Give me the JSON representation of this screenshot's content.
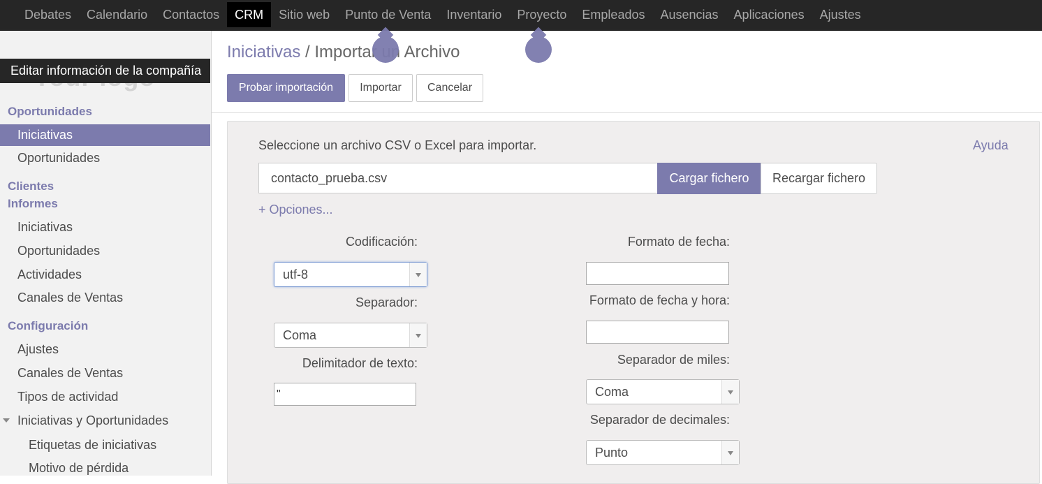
{
  "nav": {
    "items": [
      "Debates",
      "Calendario",
      "Contactos",
      "CRM",
      "Sitio web",
      "Punto de Venta",
      "Inventario",
      "Proyecto",
      "Empleados",
      "Ausencias",
      "Aplicaciones",
      "Ajustes"
    ],
    "active": "CRM"
  },
  "sidebar": {
    "logo_text": "Your logo",
    "company_tooltip": "Editar información de la compañía",
    "sections": {
      "oportunidades": "Oportunidades",
      "clientes": "Clientes",
      "informes": "Informes",
      "configuracion": "Configuración"
    },
    "items": {
      "iniciativas": "Iniciativas",
      "oportunidades": "Oportunidades",
      "inf_iniciativas": "Iniciativas",
      "inf_oportunidades": "Oportunidades",
      "inf_actividades": "Actividades",
      "inf_canales": "Canales de Ventas",
      "conf_ajustes": "Ajustes",
      "conf_canales": "Canales de Ventas",
      "conf_tipos": "Tipos de actividad",
      "conf_iniciativas_op": "Iniciativas y Oportunidades",
      "conf_etiquetas": "Etiquetas de iniciativas",
      "conf_motivo": "Motivo de pérdida"
    }
  },
  "header": {
    "breadcrumb_link": "Iniciativas",
    "breadcrumb_sep": "/",
    "breadcrumb_current": "Importar un Archivo",
    "buttons": {
      "test": "Probar importación",
      "import": "Importar",
      "cancel": "Cancelar"
    }
  },
  "import": {
    "prompt": "Seleccione un archivo CSV o Excel para importar.",
    "help": "Ayuda",
    "file_name": "contacto_prueba.csv",
    "load_button": "Cargar fichero",
    "reload_button": "Recargar fichero",
    "options_toggle": "+ Opciones...",
    "encoding_label": "Codificación:",
    "encoding_value": "utf-8",
    "separator_label": "Separador:",
    "separator_value": "Coma",
    "text_delimiter_label": "Delimitador de texto:",
    "text_delimiter_value": "\"",
    "date_format_label": "Formato de fecha:",
    "date_format_value": "",
    "datetime_format_label": "Formato de fecha y hora:",
    "datetime_format_value": "",
    "thousands_label": "Separador de miles:",
    "thousands_value": "Coma",
    "decimal_label": "Separador de decimales:",
    "decimal_value": "Punto"
  },
  "colors": {
    "brand": "#7c7bad",
    "navbar": "#262626"
  }
}
